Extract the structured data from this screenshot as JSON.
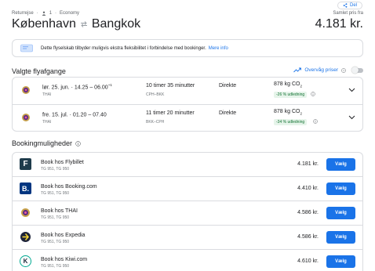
{
  "header": {
    "share_label": "Del",
    "trip_type": "Returrejse",
    "passengers": "1",
    "cabin": "Economy",
    "origin": "København",
    "destination": "Bangkok",
    "price_label": "Samlet pris fra",
    "total_price": "4.181 kr."
  },
  "notice": {
    "text": "Dette flyselskab tilbyder muligvis ekstra fleksibilitet i forbindelse med bookinger.",
    "link": "Mere info"
  },
  "flights_section": {
    "title": "Valgte flyafgange",
    "track_label": "Overvåg priser",
    "flights": [
      {
        "date": "lør. 25. jun.",
        "times": "14.25 – 06.00",
        "plus": "+1",
        "carrier": "THAI",
        "duration": "10 timer 35 minutter",
        "codes": "CPH–BKK",
        "stops": "Direkte",
        "co2": "878 kg CO",
        "co2_sub": "2",
        "badge": "-26 % udledning"
      },
      {
        "date": "fre. 15. jul.",
        "times": "01.20 – 07.40",
        "plus": "",
        "carrier": "THAI",
        "duration": "11 timer 20 minutter",
        "codes": "BKK–CPH",
        "stops": "Direkte",
        "co2": "878 kg CO",
        "co2_sub": "2",
        "badge": "-34 % udledning"
      }
    ]
  },
  "booking_section": {
    "title": "Bookingmuligheder",
    "select_label": "Vælg",
    "options": [
      {
        "name": "Book hos Flybillet",
        "flights": "TG 951, TG 950",
        "price": "4.181 kr.",
        "logo": "flybillet-logo",
        "logo_letter": "F"
      },
      {
        "name": "Book hos Booking.com",
        "flights": "TG 951, TG 950",
        "price": "4.410 kr.",
        "logo": "booking-logo",
        "logo_letter": "B."
      },
      {
        "name": "Book hos THAI",
        "flights": "TG 951, TG 950",
        "price": "4.586 kr.",
        "logo": "thai-logo",
        "logo_letter": ""
      },
      {
        "name": "Book hos Expedia",
        "flights": "TG 951, TG 950",
        "price": "4.586 kr.",
        "logo": "expedia-logo",
        "logo_letter": ""
      },
      {
        "name": "Book hos Kiwi.com",
        "flights": "TG 951, TG 950",
        "price": "4.610 kr.",
        "logo": "kiwi-logo",
        "logo_letter": "K"
      }
    ]
  },
  "colors": {
    "accent": "#1a73e8",
    "badge_bg": "#e6f4ea",
    "badge_text": "#137333",
    "thai_purple": "#5b2c83",
    "thai_gold": "#c8a24a"
  }
}
